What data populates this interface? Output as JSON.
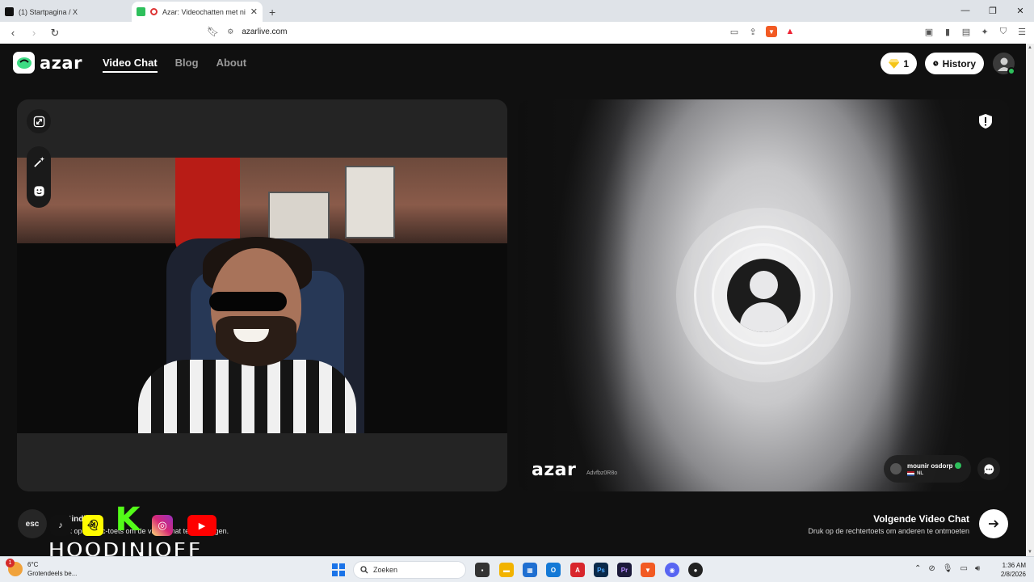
{
  "browser": {
    "tabs": [
      {
        "title": "(1) Startpagina / X",
        "active": false
      },
      {
        "title": "Azar: Videochatten met nieuw",
        "active": true
      }
    ],
    "new_tab": "+",
    "url": "azarlive.com"
  },
  "site": {
    "brand": "azar",
    "nav": [
      {
        "label": "Video Chat",
        "active": true
      },
      {
        "label": "Blog",
        "active": false
      },
      {
        "label": "About",
        "active": false
      }
    ],
    "gems": "1",
    "history_label": "History"
  },
  "remote": {
    "watermark": "azar",
    "session_id": "Advfbz0R8o",
    "partner_name": "mounir osdorp",
    "partner_country": "NL"
  },
  "bottom": {
    "esc_label": "esc",
    "stop_title": "Beëindigen",
    "stop_hint": "Druk op de esc-toets om de video chat te beëindigen.",
    "next_title": "Volgende Video Chat",
    "next_hint": "Druk op de rechtertoets om anderen te ontmoeten"
  },
  "stream_overlay": {
    "name": "HOODINIOFF",
    "k_letter": "K"
  },
  "taskbar": {
    "temperature": "6°C",
    "weather": "Grotendeels be...",
    "weather_badge": "1",
    "search_placeholder": "Zoeken",
    "time": "1:36 AM",
    "date": "2/8/2026"
  },
  "colors": {
    "accent_green": "#2ec05c",
    "brand_bg": "#101010",
    "panel": "#242424",
    "gem": "#f5c518"
  },
  "icons": [
    "expand-icon",
    "magic-wand-icon",
    "sticker-icon",
    "report-icon",
    "chat-icon",
    "arrow-right-icon",
    "clock-icon",
    "gem-icon",
    "user-icon"
  ]
}
